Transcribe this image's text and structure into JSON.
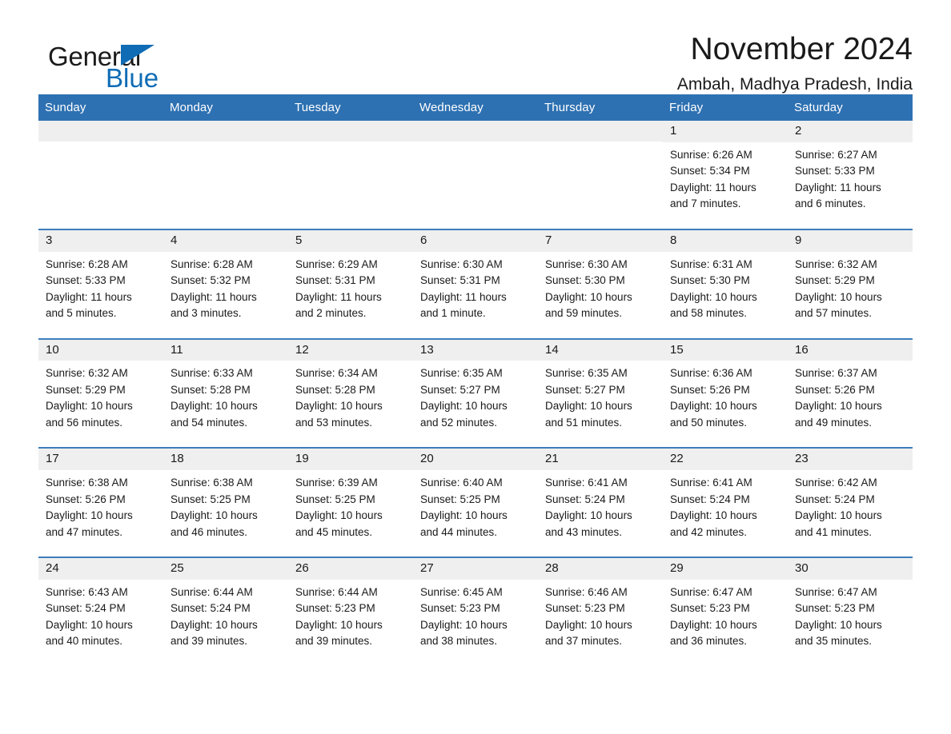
{
  "brand": {
    "word_one": "General",
    "word_two": "Blue",
    "logo_icon": "triangle-flag-icon"
  },
  "header": {
    "title": "November 2024",
    "subtitle": "Ambah, Madhya Pradesh, India"
  },
  "colors": {
    "header_blue": "#2E71B2",
    "row_separator_blue": "#3D7EBD",
    "daynum_band_gray": "#EFEFEF",
    "brand_blue": "#0F6CB5",
    "text": "#1a1a1a"
  },
  "weekday_headers": [
    "Sunday",
    "Monday",
    "Tuesday",
    "Wednesday",
    "Thursday",
    "Friday",
    "Saturday"
  ],
  "labels": {
    "sunrise_prefix": "Sunrise:",
    "sunset_prefix": "Sunset:",
    "daylight_prefix": "Daylight:"
  },
  "weeks": [
    [
      {
        "day": "",
        "empty": true
      },
      {
        "day": "",
        "empty": true
      },
      {
        "day": "",
        "empty": true
      },
      {
        "day": "",
        "empty": true
      },
      {
        "day": "",
        "empty": true
      },
      {
        "day": "1",
        "sunrise": "Sunrise: 6:26 AM",
        "sunset": "Sunset: 5:34 PM",
        "daylight": "Daylight: 11 hours and 7 minutes."
      },
      {
        "day": "2",
        "sunrise": "Sunrise: 6:27 AM",
        "sunset": "Sunset: 5:33 PM",
        "daylight": "Daylight: 11 hours and 6 minutes."
      }
    ],
    [
      {
        "day": "3",
        "sunrise": "Sunrise: 6:28 AM",
        "sunset": "Sunset: 5:33 PM",
        "daylight": "Daylight: 11 hours and 5 minutes."
      },
      {
        "day": "4",
        "sunrise": "Sunrise: 6:28 AM",
        "sunset": "Sunset: 5:32 PM",
        "daylight": "Daylight: 11 hours and 3 minutes."
      },
      {
        "day": "5",
        "sunrise": "Sunrise: 6:29 AM",
        "sunset": "Sunset: 5:31 PM",
        "daylight": "Daylight: 11 hours and 2 minutes."
      },
      {
        "day": "6",
        "sunrise": "Sunrise: 6:30 AM",
        "sunset": "Sunset: 5:31 PM",
        "daylight": "Daylight: 11 hours and 1 minute."
      },
      {
        "day": "7",
        "sunrise": "Sunrise: 6:30 AM",
        "sunset": "Sunset: 5:30 PM",
        "daylight": "Daylight: 10 hours and 59 minutes."
      },
      {
        "day": "8",
        "sunrise": "Sunrise: 6:31 AM",
        "sunset": "Sunset: 5:30 PM",
        "daylight": "Daylight: 10 hours and 58 minutes."
      },
      {
        "day": "9",
        "sunrise": "Sunrise: 6:32 AM",
        "sunset": "Sunset: 5:29 PM",
        "daylight": "Daylight: 10 hours and 57 minutes."
      }
    ],
    [
      {
        "day": "10",
        "sunrise": "Sunrise: 6:32 AM",
        "sunset": "Sunset: 5:29 PM",
        "daylight": "Daylight: 10 hours and 56 minutes."
      },
      {
        "day": "11",
        "sunrise": "Sunrise: 6:33 AM",
        "sunset": "Sunset: 5:28 PM",
        "daylight": "Daylight: 10 hours and 54 minutes."
      },
      {
        "day": "12",
        "sunrise": "Sunrise: 6:34 AM",
        "sunset": "Sunset: 5:28 PM",
        "daylight": "Daylight: 10 hours and 53 minutes."
      },
      {
        "day": "13",
        "sunrise": "Sunrise: 6:35 AM",
        "sunset": "Sunset: 5:27 PM",
        "daylight": "Daylight: 10 hours and 52 minutes."
      },
      {
        "day": "14",
        "sunrise": "Sunrise: 6:35 AM",
        "sunset": "Sunset: 5:27 PM",
        "daylight": "Daylight: 10 hours and 51 minutes."
      },
      {
        "day": "15",
        "sunrise": "Sunrise: 6:36 AM",
        "sunset": "Sunset: 5:26 PM",
        "daylight": "Daylight: 10 hours and 50 minutes."
      },
      {
        "day": "16",
        "sunrise": "Sunrise: 6:37 AM",
        "sunset": "Sunset: 5:26 PM",
        "daylight": "Daylight: 10 hours and 49 minutes."
      }
    ],
    [
      {
        "day": "17",
        "sunrise": "Sunrise: 6:38 AM",
        "sunset": "Sunset: 5:26 PM",
        "daylight": "Daylight: 10 hours and 47 minutes."
      },
      {
        "day": "18",
        "sunrise": "Sunrise: 6:38 AM",
        "sunset": "Sunset: 5:25 PM",
        "daylight": "Daylight: 10 hours and 46 minutes."
      },
      {
        "day": "19",
        "sunrise": "Sunrise: 6:39 AM",
        "sunset": "Sunset: 5:25 PM",
        "daylight": "Daylight: 10 hours and 45 minutes."
      },
      {
        "day": "20",
        "sunrise": "Sunrise: 6:40 AM",
        "sunset": "Sunset: 5:25 PM",
        "daylight": "Daylight: 10 hours and 44 minutes."
      },
      {
        "day": "21",
        "sunrise": "Sunrise: 6:41 AM",
        "sunset": "Sunset: 5:24 PM",
        "daylight": "Daylight: 10 hours and 43 minutes."
      },
      {
        "day": "22",
        "sunrise": "Sunrise: 6:41 AM",
        "sunset": "Sunset: 5:24 PM",
        "daylight": "Daylight: 10 hours and 42 minutes."
      },
      {
        "day": "23",
        "sunrise": "Sunrise: 6:42 AM",
        "sunset": "Sunset: 5:24 PM",
        "daylight": "Daylight: 10 hours and 41 minutes."
      }
    ],
    [
      {
        "day": "24",
        "sunrise": "Sunrise: 6:43 AM",
        "sunset": "Sunset: 5:24 PM",
        "daylight": "Daylight: 10 hours and 40 minutes."
      },
      {
        "day": "25",
        "sunrise": "Sunrise: 6:44 AM",
        "sunset": "Sunset: 5:24 PM",
        "daylight": "Daylight: 10 hours and 39 minutes."
      },
      {
        "day": "26",
        "sunrise": "Sunrise: 6:44 AM",
        "sunset": "Sunset: 5:23 PM",
        "daylight": "Daylight: 10 hours and 39 minutes."
      },
      {
        "day": "27",
        "sunrise": "Sunrise: 6:45 AM",
        "sunset": "Sunset: 5:23 PM",
        "daylight": "Daylight: 10 hours and 38 minutes."
      },
      {
        "day": "28",
        "sunrise": "Sunrise: 6:46 AM",
        "sunset": "Sunset: 5:23 PM",
        "daylight": "Daylight: 10 hours and 37 minutes."
      },
      {
        "day": "29",
        "sunrise": "Sunrise: 6:47 AM",
        "sunset": "Sunset: 5:23 PM",
        "daylight": "Daylight: 10 hours and 36 minutes."
      },
      {
        "day": "30",
        "sunrise": "Sunrise: 6:47 AM",
        "sunset": "Sunset: 5:23 PM",
        "daylight": "Daylight: 10 hours and 35 minutes."
      }
    ]
  ]
}
